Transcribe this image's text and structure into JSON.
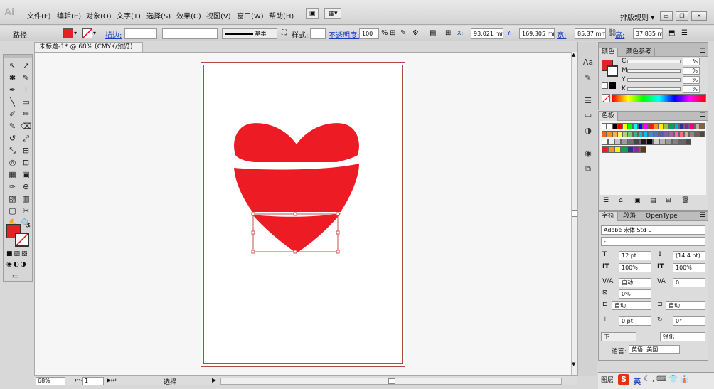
{
  "app": {
    "logo_text": "Ai"
  },
  "menu": [
    "文件(F)",
    "编辑(E)",
    "对象(O)",
    "文字(T)",
    "选择(S)",
    "效果(C)",
    "视图(V)",
    "窗口(W)",
    "帮助(H)"
  ],
  "workspace": {
    "label": "排版规则",
    "dropdown": "▾"
  },
  "window_controls": {
    "minimize": "▭",
    "restore": "❐",
    "close": "✕"
  },
  "control_bar": {
    "object_type": "路径",
    "stroke_link": "描边:",
    "stroke_style": "基本",
    "style_label": "样式:",
    "opacity_link": "不透明度:",
    "opacity_value": "100",
    "pct": "%",
    "x_label": "X:",
    "x_value": "93.021 mm",
    "y_label": "Y:",
    "y_value": "169.305 mm",
    "w_label": "宽:",
    "w_value": "85.37 mm",
    "h_label": "高:",
    "h_value": "37.835 mm",
    "fill_color": "#e32227"
  },
  "document": {
    "tab_title": "未标题-1* @ 68% (CMYK/预览)",
    "close": "✕",
    "heart_color": "#ed1c24",
    "zoom": "68%",
    "page": "1",
    "status_text": "选择"
  },
  "toolbox": {
    "tools": [
      "↖",
      "↗",
      "✱",
      "✎",
      "✒",
      "T",
      "╲",
      "▭",
      "✐",
      "✏",
      "✎",
      "⌫",
      "↺",
      "⤢",
      "⤡",
      "⊞",
      "◎",
      "⊡",
      "▦",
      "▣",
      "✑",
      "⊕",
      "▧",
      "▥",
      "▢",
      "✂",
      "✋",
      "🔍"
    ],
    "fill_color": "#e32227",
    "stroke_color": "#ffffff"
  },
  "color_panel": {
    "tabs": [
      "颜色",
      "颜色参考"
    ],
    "channels": [
      {
        "label": "C",
        "value": "%"
      },
      {
        "label": "M",
        "value": "%"
      },
      {
        "label": "Y",
        "value": "%"
      },
      {
        "label": "K",
        "value": "%"
      }
    ],
    "fill_color": "#e32227"
  },
  "swatches_panel": {
    "tab": "色板",
    "rows": [
      [
        "#ffffff",
        "#ffffff",
        "#000000",
        "#ff0000",
        "#ffff00",
        "#00ff00",
        "#00ffff",
        "#0000ff",
        "#ff00ff",
        "#ed1c24",
        "#f7941d",
        "#fff200",
        "#8dc63f",
        "#00a651",
        "#00aeef",
        "#2e3192",
        "#92278f",
        "#ec008c",
        "#c2b59b",
        "#8c6239"
      ],
      [
        "#f26522",
        "#f7941d",
        "#fbaf5d",
        "#fff568",
        "#acd373",
        "#7cc576",
        "#3bb878",
        "#1abbb4",
        "#00bff3",
        "#438ccb",
        "#5574b9",
        "#605ca8",
        "#855fa8",
        "#a763a9",
        "#f06eaa",
        "#f26d7d",
        "#c7b299",
        "#998675",
        "#736357",
        "#534741"
      ],
      [
        "#ffffff",
        "#ececec",
        "#c4c4c4",
        "#9b9b9b",
        "#707070",
        "#464646",
        "#1a1a1a",
        "#000000",
        "#cccccc",
        "#b3b3b3",
        "#999999",
        "#808080",
        "#666666",
        "#4d4d4d"
      ],
      [
        "#ed1c24",
        "#f7941d",
        "#fff200",
        "#00a651",
        "#2e3192",
        "#92278f",
        "#603913"
      ]
    ],
    "footer_icons": [
      "☰",
      "⌂",
      "▣",
      "▤",
      "⊞",
      "🗑"
    ]
  },
  "char_panel": {
    "tabs": [
      "字符",
      "段落",
      "OpenType"
    ],
    "font": "Adobe 宋体 Std L",
    "style": "-",
    "size": "12 pt",
    "leading": "(14.4 pt)",
    "scale_v": "100%",
    "scale_h": "100%",
    "kerning": "自动",
    "tracking": "0",
    "tsume": "0%",
    "aki_left": "自动",
    "aki_right": "自动",
    "baseline": "0 pt",
    "rotation": "0°",
    "underline_label": "下",
    "smooth_label": "锐化",
    "language_label": "语言:",
    "language": "英语: 美国"
  },
  "bottom": {
    "layers_tab": "图层",
    "ime": "英"
  }
}
